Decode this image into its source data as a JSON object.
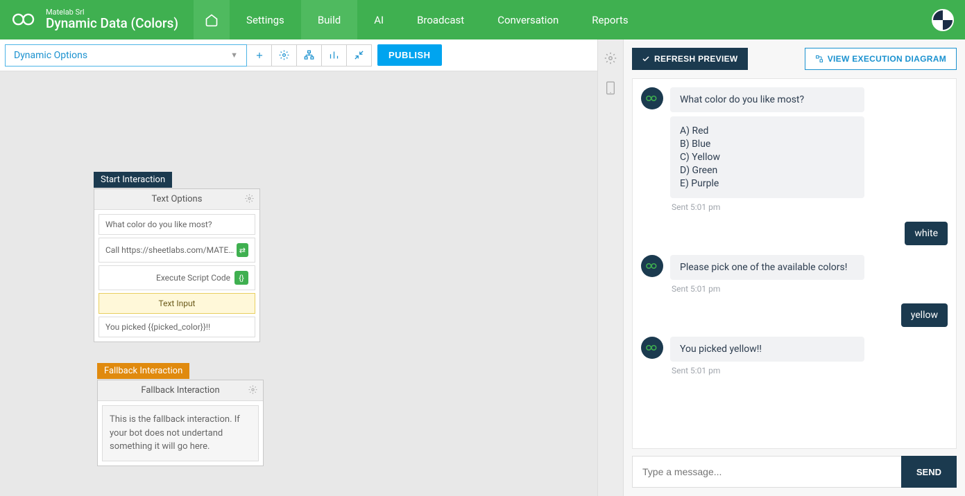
{
  "header": {
    "subtitle": "Matelab Srl",
    "title": "Dynamic Data (Colors)",
    "nav": {
      "settings": "Settings",
      "build": "Build",
      "ai": "AI",
      "broadcast": "Broadcast",
      "conversation": "Conversation",
      "reports": "Reports"
    }
  },
  "toolbar": {
    "dropdown": "Dynamic Options",
    "publish": "PUBLISH"
  },
  "nodes": {
    "start": {
      "label": "Start Interaction",
      "header": "Text Options",
      "rows": {
        "q": "What color do you like most?",
        "call": "Call https://sheetlabs.com/MATE/Colors",
        "exec": "Execute Script Code",
        "input": "Text Input",
        "picked": "You picked {{picked_color}}!!"
      }
    },
    "fallback": {
      "label": "Fallback Interaction",
      "header": "Fallback Interaction",
      "body": "This is the fallback interaction. If your bot does not undertand something it will go here."
    }
  },
  "preview": {
    "refresh": "REFRESH PREVIEW",
    "diagram": "VIEW EXECUTION DIAGRAM",
    "messages": {
      "m1": "What color do you like most?",
      "opts": {
        "a": "A) Red",
        "b": "B) Blue",
        "c": "C) Yellow",
        "d": "D) Green",
        "e": "E) Purple"
      },
      "ts1": "Sent 5:01 pm",
      "u1": "white",
      "m2": "Please pick one of the available colors!",
      "ts2": "Sent 5:01 pm",
      "u2": "yellow",
      "m3": "You picked yellow!!",
      "ts3": "Sent 5:01 pm"
    },
    "input_placeholder": "Type a message...",
    "send": "SEND"
  }
}
